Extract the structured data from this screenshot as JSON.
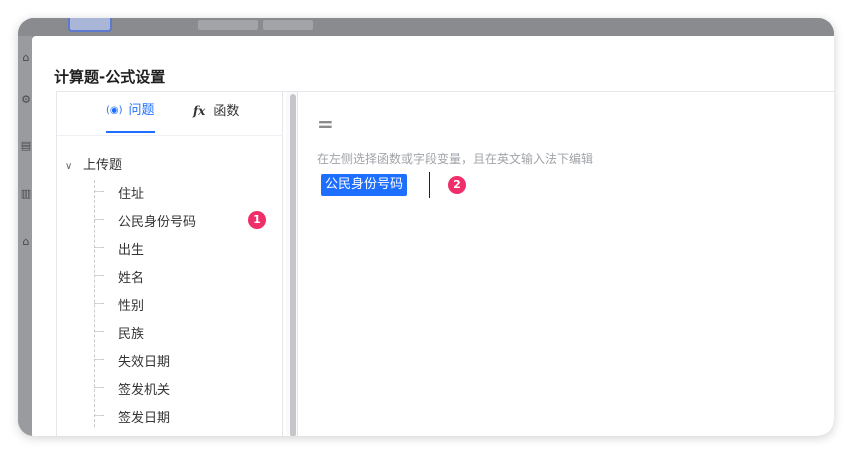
{
  "dialog": {
    "title": "计算题-公式设置"
  },
  "tabs": [
    {
      "label": "问题",
      "icon": "variable-icon",
      "active": true
    },
    {
      "label": "函数",
      "icon": "function-icon",
      "active": false
    }
  ],
  "tree": {
    "root_label": "上传题",
    "items": [
      "住址",
      "公民身份号码",
      "出生",
      "姓名",
      "性别",
      "民族",
      "失效日期",
      "签发机关",
      "签发日期"
    ]
  },
  "editor": {
    "operator": "=",
    "hint": "在左侧选择函数或字段变量，且在英文输入法下编辑",
    "token": "公民身份号码"
  },
  "annotations": {
    "step1": "1",
    "step2": "2"
  },
  "colors": {
    "accent": "#1e6fff",
    "badge": "#ef2e6a"
  }
}
